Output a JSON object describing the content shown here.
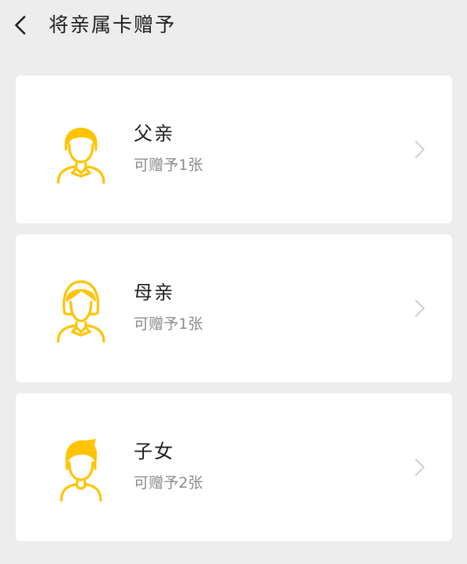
{
  "header": {
    "back_icon": "chevron-left-icon",
    "title": "将亲属卡赠予"
  },
  "colors": {
    "background": "#ededed",
    "card": "#ffffff",
    "accent": "#ffc400",
    "primary_text": "#1e1e1e",
    "secondary_text": "#8c8c8c",
    "chevron": "#cfcfcf"
  },
  "members": [
    {
      "name": "父亲",
      "quota": "可赠予1张",
      "icon": "father-avatar-icon"
    },
    {
      "name": "母亲",
      "quota": "可赠予1张",
      "icon": "mother-avatar-icon"
    },
    {
      "name": "子女",
      "quota": "可赠予2张",
      "icon": "child-avatar-icon"
    }
  ]
}
